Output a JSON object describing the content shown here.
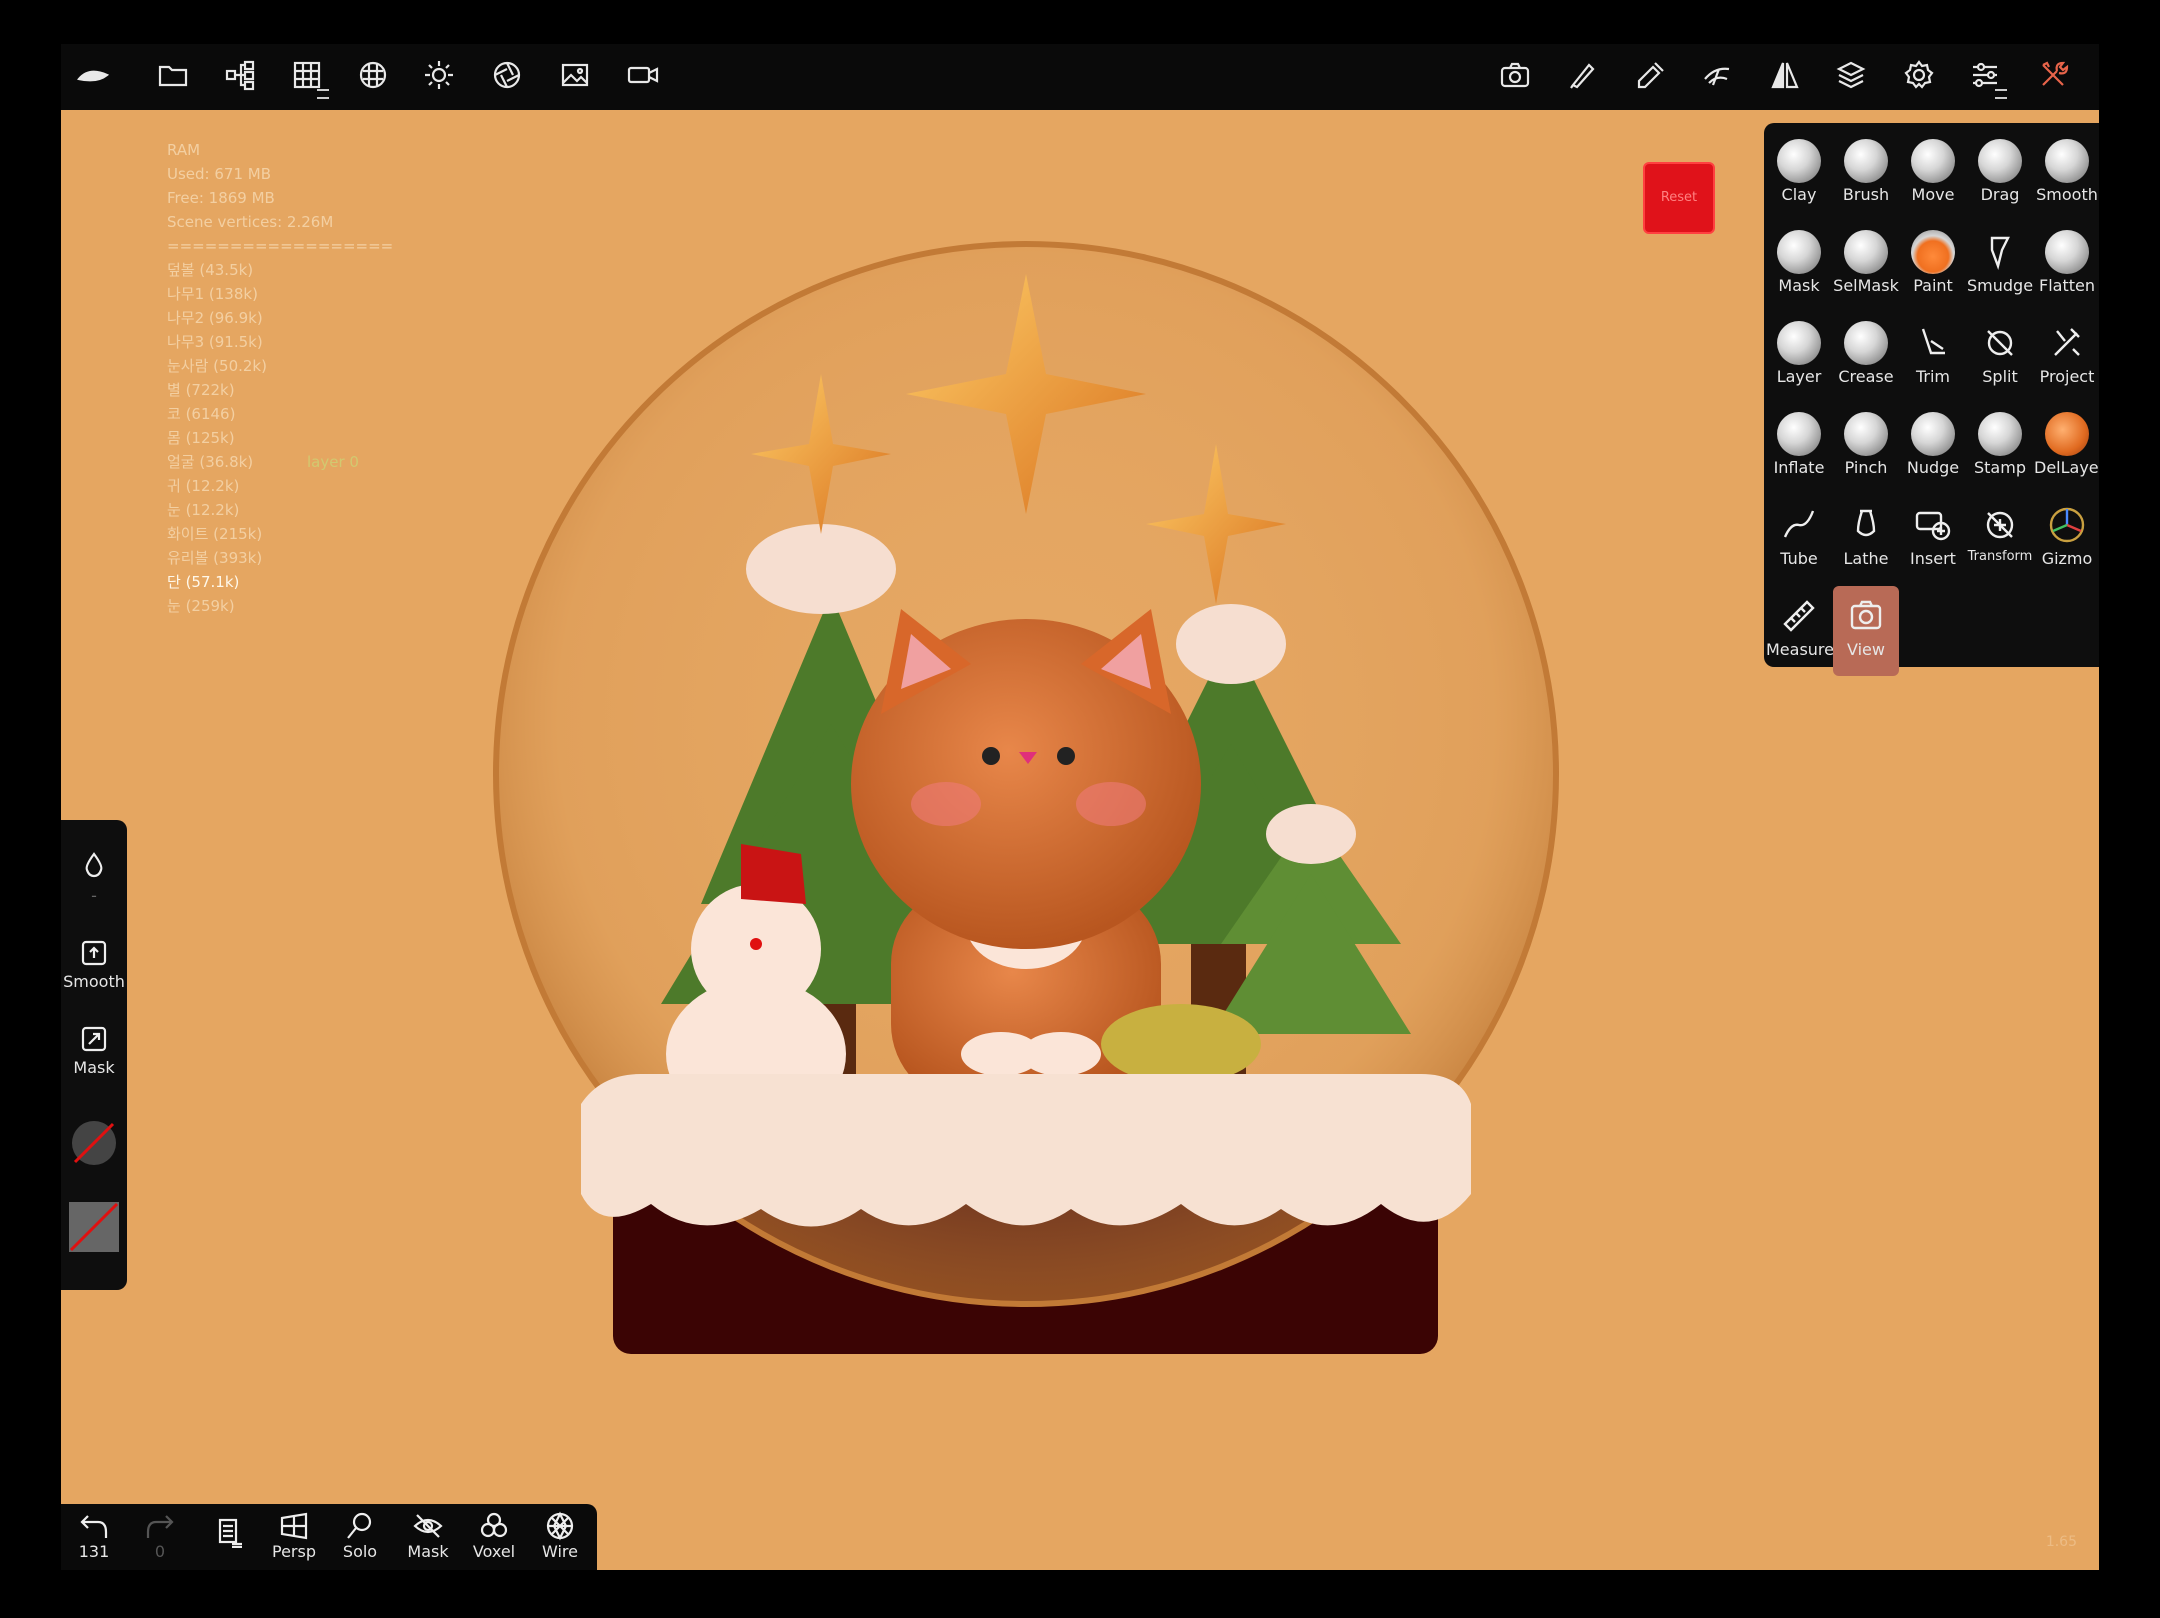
{
  "stats": {
    "lines": [
      "RAM",
      "Used: 671 MB",
      "Free: 1869 MB",
      "Scene vertices: 2.26M",
      "=================="
    ],
    "objects": [
      "덮볼 (43.5k)",
      "나무1 (138k)",
      "나무2 (96.9k)",
      "나무3 (91.5k)",
      "눈사람 (50.2k)",
      "별 (722k)",
      "코 (6146)",
      "몸 (125k)",
      "얼굴 (36.8k)",
      "귀 (12.2k)",
      "눈 (12.2k)",
      "화이트 (215k)",
      "유리볼 (393k)",
      "단 (57.1k)",
      "눈 (259k)"
    ],
    "active_object_index": 13,
    "layer_label": "layer 0"
  },
  "reset_label": "Reset",
  "top_left_icons": [
    "logo-icon",
    "folder-icon",
    "scene-tree-icon",
    "grid-icon",
    "material-sphere-icon",
    "sun-icon",
    "aperture-icon",
    "image-icon",
    "video-icon"
  ],
  "top_right_icons": [
    "camera-icon",
    "brush-pen-icon",
    "eyedropper-icon",
    "stroke-tool-icon",
    "symmetry-icon",
    "layers-icon",
    "settings-gear-icon",
    "sliders-icon",
    "tools-wrench-icon"
  ],
  "tools": [
    {
      "label": "Clay",
      "icon": "clay-icon"
    },
    {
      "label": "Brush",
      "icon": "brush-icon"
    },
    {
      "label": "Move",
      "icon": "move-icon"
    },
    {
      "label": "Drag",
      "icon": "drag-icon"
    },
    {
      "label": "Smooth",
      "icon": "smooth-icon"
    },
    {
      "label": "Mask",
      "icon": "mask-icon"
    },
    {
      "label": "SelMask",
      "icon": "selmask-icon"
    },
    {
      "label": "Paint",
      "icon": "paint-icon"
    },
    {
      "label": "Smudge",
      "icon": "smudge-icon"
    },
    {
      "label": "Flatten",
      "icon": "flatten-icon"
    },
    {
      "label": "Layer",
      "icon": "layer-icon"
    },
    {
      "label": "Crease",
      "icon": "crease-icon"
    },
    {
      "label": "Trim",
      "icon": "trim-icon"
    },
    {
      "label": "Split",
      "icon": "split-icon"
    },
    {
      "label": "Project",
      "icon": "project-icon"
    },
    {
      "label": "Inflate",
      "icon": "inflate-icon"
    },
    {
      "label": "Pinch",
      "icon": "pinch-icon"
    },
    {
      "label": "Nudge",
      "icon": "nudge-icon"
    },
    {
      "label": "Stamp",
      "icon": "stamp-icon"
    },
    {
      "label": "DelLayer",
      "icon": "dellayer-icon"
    },
    {
      "label": "Tube",
      "icon": "tube-icon"
    },
    {
      "label": "Lathe",
      "icon": "lathe-icon"
    },
    {
      "label": "Insert",
      "icon": "insert-icon"
    },
    {
      "label": "Transform",
      "icon": "transform-icon"
    },
    {
      "label": "Gizmo",
      "icon": "gizmo-icon"
    },
    {
      "label": "Measure",
      "icon": "measure-icon"
    },
    {
      "label": "View",
      "icon": "view-camera-icon"
    }
  ],
  "selected_tool": "View",
  "left_panel": {
    "smooth_label": "Smooth",
    "mask_label": "Mask",
    "dash": "-"
  },
  "bottom": {
    "undo_count": "131",
    "redo_count": "0",
    "persp_label": "Persp",
    "solo_label": "Solo",
    "mask_label": "Mask",
    "voxel_label": "Voxel",
    "wire_label": "Wire"
  },
  "version": "1.65",
  "colors": {
    "background": "#e5a661",
    "bar": "#0a0a0a",
    "selected_tool": "#b86a56",
    "reset": "#e0121a"
  }
}
